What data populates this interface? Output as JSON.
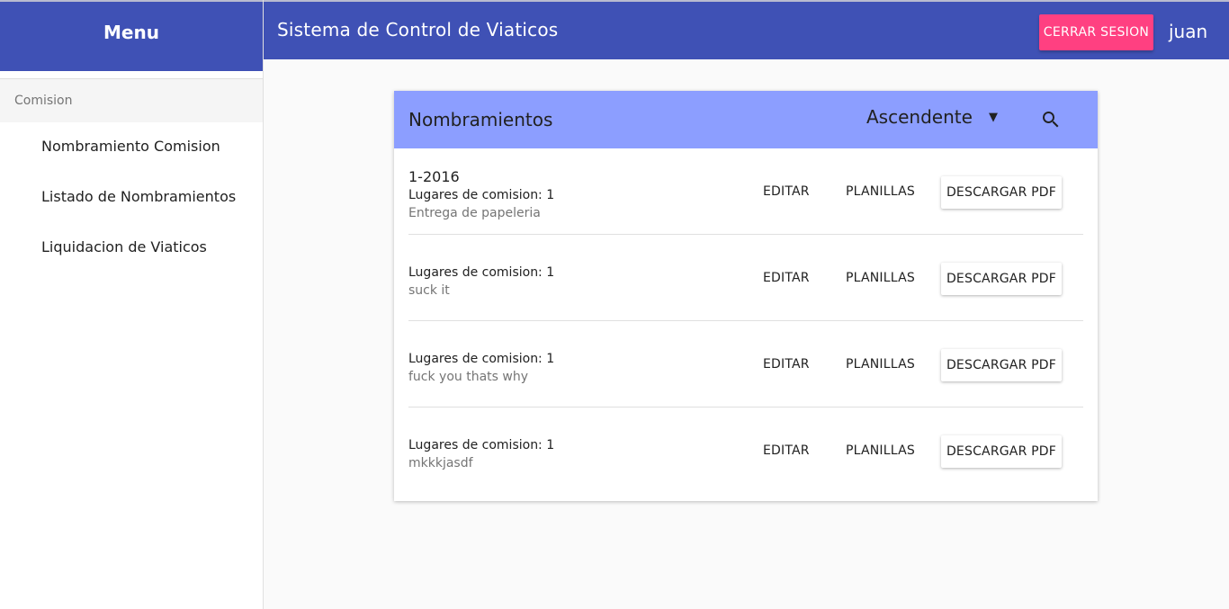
{
  "header": {
    "title": "Sistema de Control de Viaticos",
    "logout_label": "CERRAR SESION",
    "username": "juan"
  },
  "sidebar": {
    "title": "Menu",
    "section": "Comision",
    "items": [
      {
        "label": "Nombramiento Comision"
      },
      {
        "label": "Listado de Nombramientos"
      },
      {
        "label": "Liquidacion de Viaticos"
      }
    ]
  },
  "card": {
    "title": "Nombramientos",
    "sort_value": "Ascendente",
    "rows": [
      {
        "title": "1-2016",
        "line1": "Lugares de comision: 1",
        "line2": "Entrega de papeleria"
      },
      {
        "title": "",
        "line1": "Lugares de comision: 1",
        "line2": "suck it"
      },
      {
        "title": "",
        "line1": "Lugares de comision: 1",
        "line2": "fuck you thats why"
      },
      {
        "title": "",
        "line1": "Lugares de comision: 1",
        "line2": "mkkkjasdf"
      }
    ],
    "actions": {
      "edit": "EDITAR",
      "planillas": "PLANILLAS",
      "download": "DESCARGAR PDF"
    }
  },
  "colors": {
    "primary": "#3f51b5",
    "accent": "#ff4081",
    "card_header": "#8c9eff"
  },
  "icons": {
    "search": "search-icon",
    "dropdown": "arrow-drop-down-icon"
  }
}
